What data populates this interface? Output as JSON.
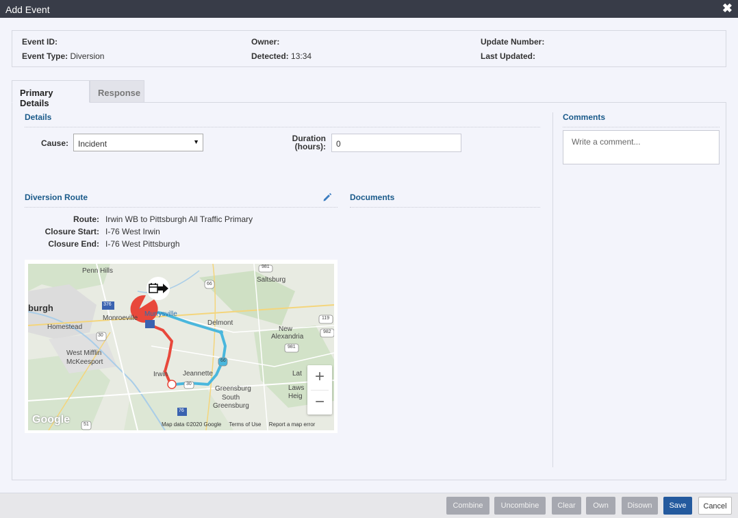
{
  "window": {
    "title": "Add Event",
    "close_icon": "close-icon"
  },
  "info": {
    "event_id_label": "Event ID:",
    "event_type_label": "Event Type:",
    "event_type_value": "Diversion",
    "owner_label": "Owner:",
    "detected_label": "Detected:",
    "detected_value": "13:34",
    "update_number_label": "Update Number:",
    "last_updated_label": "Last Updated:"
  },
  "tabs": [
    {
      "label": "Primary Details",
      "active": true
    },
    {
      "label": "Response",
      "active": false
    }
  ],
  "details": {
    "title": "Details",
    "cause_label": "Cause:",
    "cause_value": "Incident",
    "duration_label_1": "Duration",
    "duration_label_2": "(hours):",
    "duration_value": "0"
  },
  "comments": {
    "title": "Comments",
    "placeholder": "Write a comment..."
  },
  "diversion": {
    "title": "Diversion Route",
    "edit_icon": "pencil-icon",
    "route_label": "Route:",
    "route_value": "Irwin WB to Pittsburgh All Traffic Primary",
    "closure_start_label": "Closure Start:",
    "closure_start_value": "I-76 West Irwin",
    "closure_end_label": "Closure End:",
    "closure_end_value": "I-76 West Pittsburgh"
  },
  "documents": {
    "title": "Documents"
  },
  "map": {
    "places": [
      "Penn Hills",
      "Saltsburg",
      "burgh",
      "Monroeville",
      "Murrysville",
      "Delmont",
      "Homestead",
      "New",
      "Alexandria",
      "West Mifflin",
      "McKeesport",
      "Irwin",
      "Jeannette",
      "Greensburg",
      "South",
      "Greensburg",
      "Lat",
      "Laws",
      "Heig"
    ],
    "shields": [
      "981",
      "66",
      "376",
      "119",
      "982",
      "30",
      "981",
      "66",
      "30",
      "76",
      "51"
    ],
    "zoom_in": "+",
    "zoom_out": "−",
    "attribution": [
      "Map data ©2020 Google",
      "Terms of Use",
      "Report a map error"
    ],
    "logo": "Google",
    "colors": {
      "closure_route": "#e8483b",
      "diversion_route": "#4ab7dd"
    }
  },
  "footer": {
    "buttons": [
      {
        "label": "Combine",
        "state": "disabled"
      },
      {
        "label": "Uncombine",
        "state": "disabled"
      },
      {
        "label": "Clear",
        "state": "disabled"
      },
      {
        "label": "Own",
        "state": "disabled"
      },
      {
        "label": "Disown",
        "state": "disabled"
      },
      {
        "label": "Save",
        "state": "primary"
      },
      {
        "label": "Cancel",
        "state": "outline"
      }
    ]
  }
}
